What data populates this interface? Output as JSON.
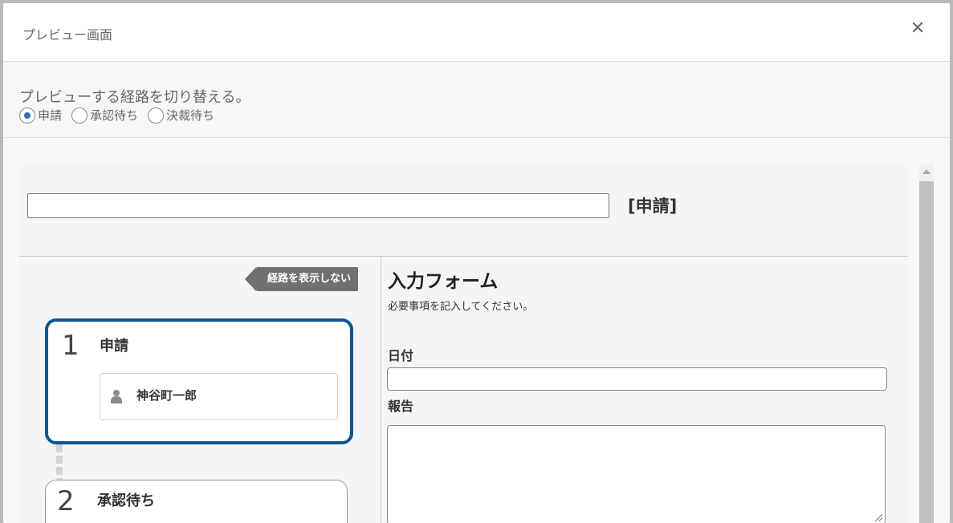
{
  "modal": {
    "title": "プレビュー画面",
    "close_icon": "close-icon"
  },
  "route_switch": {
    "heading": "プレビューする経路を切り替える。",
    "options": [
      {
        "label": "申請",
        "checked": true
      },
      {
        "label": "承認待ち",
        "checked": false
      },
      {
        "label": "決裁待ち",
        "checked": false
      }
    ]
  },
  "preview": {
    "title_input_value": "",
    "form_type": "[申請]",
    "route_toggle_label": "経路を表示しない",
    "steps": [
      {
        "number": "1",
        "name": "申請",
        "assignee": "神谷町一郎",
        "active": true
      },
      {
        "number": "2",
        "name": "承認待ち",
        "active": false
      }
    ],
    "form": {
      "title": "入力フォーム",
      "description": "必要事項を記入してください。",
      "fields": [
        {
          "label": "日付",
          "value": ""
        },
        {
          "label": "報告",
          "value": ""
        }
      ]
    }
  },
  "colors": {
    "active_step_border": "#0e5592",
    "radio_checked": "#2f6fb1",
    "toggle_bg": "#707070"
  }
}
